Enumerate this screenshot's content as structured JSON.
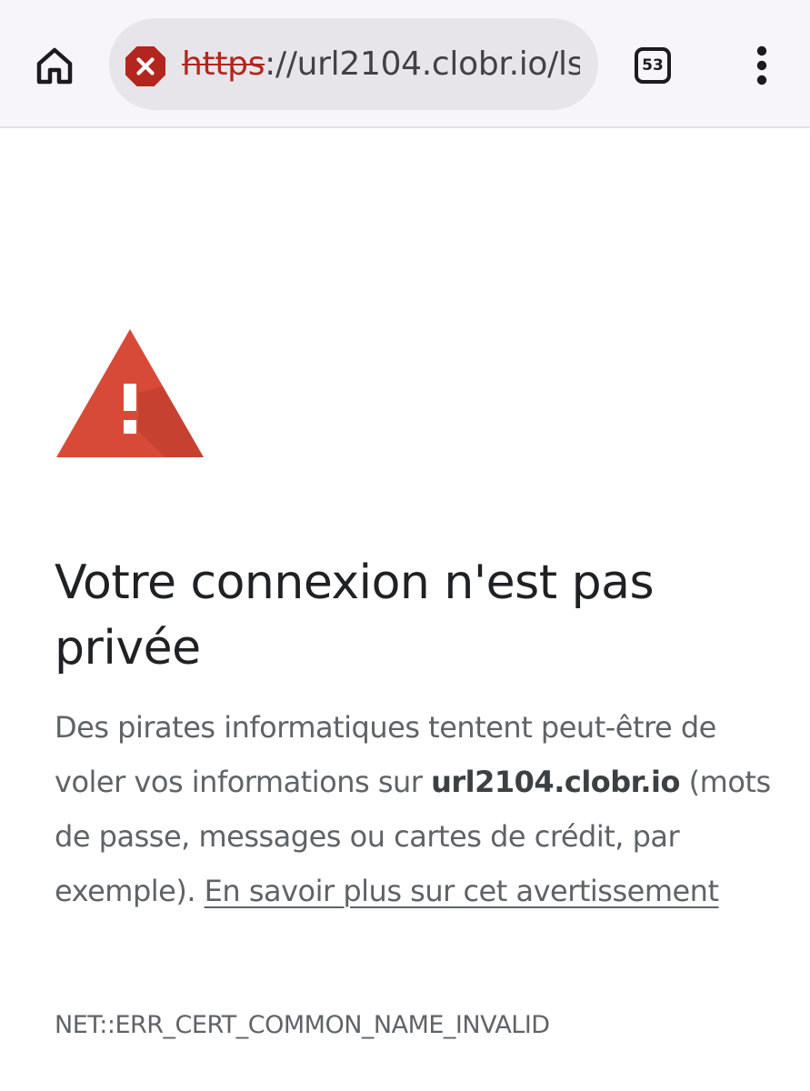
{
  "browser": {
    "url_scheme": "https",
    "url_rest": "://url2104.clobr.io/ls",
    "tab_count": "53",
    "icons": {
      "home": "home-icon",
      "security": "not-secure-icon",
      "tabs": "tab-switcher-icon",
      "menu": "more-vert-icon"
    },
    "colors": {
      "toolbar_bg": "#f7f4fa",
      "omnibox_bg": "#e7e5ea",
      "insecure_red": "#b3261e"
    }
  },
  "interstitial": {
    "headline": "Votre connexion n'est pas privée",
    "body_intro": "Des pirates informatiques tentent peut-être de voler vos informations sur ",
    "domain": "url2104.clobr.io",
    "body_rest": " (mots de passe, messages ou cartes de crédit, par exemple). ",
    "learn_more": "En savoir plus sur cet avertissement",
    "error_code": "NET::ERR_CERT_COMMON_NAME_INVALID",
    "icon": "warning-triangle-icon",
    "colors": {
      "warning_red": "#d84a38",
      "headline": "#202124",
      "body": "#5f6368"
    }
  }
}
